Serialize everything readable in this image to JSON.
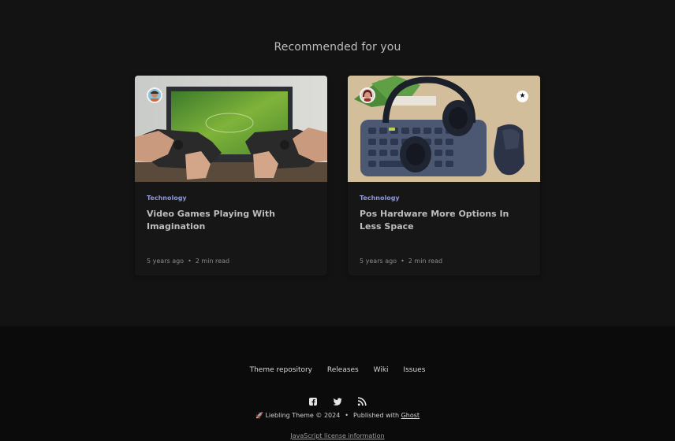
{
  "recommended": {
    "heading": "Recommended for you",
    "cards": [
      {
        "tag": "Technology",
        "title": "Video Games Playing With Imagination",
        "age": "5 years ago",
        "read_time": "2 min read",
        "featured": false
      },
      {
        "tag": "Technology",
        "title": "Pos Hardware More Options In Less Space",
        "age": "5 years ago",
        "read_time": "2 min read",
        "featured": true,
        "featured_icon": "★"
      }
    ]
  },
  "footer": {
    "links": [
      "Theme repository",
      "Releases",
      "Wiki",
      "Issues"
    ],
    "social_icons": [
      "facebook-icon",
      "twitter-icon",
      "rss-icon"
    ],
    "copyright_prefix": "🚀 Liebling Theme © 2024",
    "separator": "•",
    "published_with": "Published with",
    "ghost_link": "Ghost",
    "license_link": "JavaScript license information"
  },
  "colors": {
    "background": "#131313",
    "footer_background": "#0b0b0b",
    "tag": "#8e98d6"
  }
}
